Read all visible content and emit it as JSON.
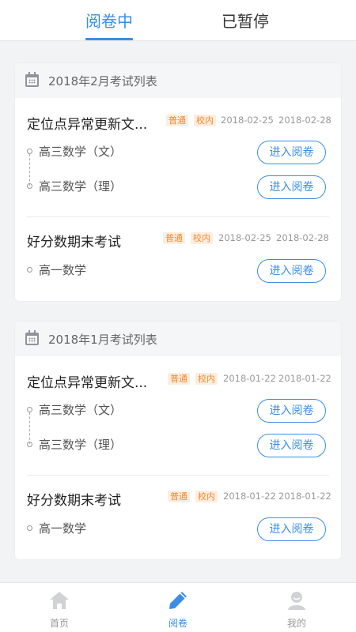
{
  "tabs": [
    {
      "label": "阅卷中",
      "active": true
    },
    {
      "label": "已暂停",
      "active": false
    }
  ],
  "months": [
    {
      "title": "2018年2月考试列表",
      "exams": [
        {
          "title": "定位点异常更新文...",
          "tags": [
            "普通",
            "校内"
          ],
          "start": "2018-02-25",
          "end": "2018-02-28",
          "subjects": [
            {
              "name": "高三数学（文）",
              "button": "进入阅卷"
            },
            {
              "name": "高三数学（理）",
              "button": "进入阅卷"
            }
          ]
        },
        {
          "title": "好分数期末考试",
          "tags": [
            "普通",
            "校内"
          ],
          "start": "2018-02-25",
          "end": "2018-02-28",
          "subjects": [
            {
              "name": "高一数学",
              "button": "进入阅卷"
            }
          ]
        }
      ]
    },
    {
      "title": "2018年1月考试列表",
      "exams": [
        {
          "title": "定位点异常更新文...",
          "tags": [
            "普通",
            "校内"
          ],
          "start": "2018-01-22",
          "end": "2018-01-22",
          "subjects": [
            {
              "name": "高三数学（文）",
              "button": "进入阅卷"
            },
            {
              "name": "高三数学（理）",
              "button": "进入阅卷"
            }
          ]
        },
        {
          "title": "好分数期末考试",
          "tags": [
            "普通",
            "校内"
          ],
          "start": "2018-01-22",
          "end": "2018-01-22",
          "subjects": [
            {
              "name": "高一数学",
              "button": "进入阅卷"
            }
          ]
        }
      ]
    }
  ],
  "bottom_nav": [
    {
      "label": "首页",
      "icon": "home-icon",
      "active": false
    },
    {
      "label": "阅卷",
      "icon": "pencil-icon",
      "active": true
    },
    {
      "label": "我的",
      "icon": "person-icon",
      "active": false
    }
  ],
  "colors": {
    "accent": "#3a8ee6",
    "tag_text": "#f5892a",
    "tag_bg": "#fdeee0",
    "background": "#f2f3f5"
  }
}
